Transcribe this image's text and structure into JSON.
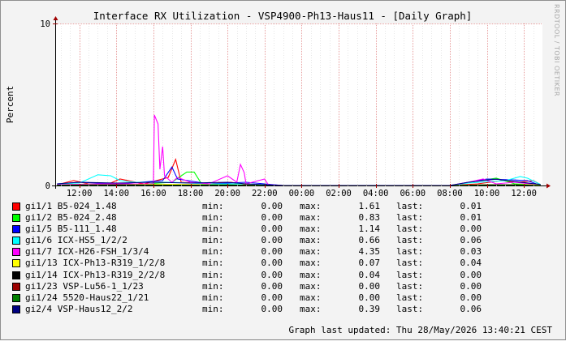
{
  "chart_data": {
    "type": "line",
    "title": "Interface RX Utilization - VSP4900-Ph13-Haus11 - [Daily Graph]",
    "ylabel": "Percent",
    "ylim": [
      0,
      10
    ],
    "yticks": [
      "0",
      "10"
    ],
    "xticks": [
      "12:00",
      "14:00",
      "16:00",
      "18:00",
      "20:00",
      "22:00",
      "00:00",
      "02:00",
      "04:00",
      "06:00",
      "08:00",
      "10:00",
      "12:00"
    ],
    "grid": true,
    "legend_position": "bottom",
    "series": [
      {
        "name": "gi1/1 B5-024_1.48",
        "color": "#ff0000",
        "min": "0.00",
        "max": "1.61",
        "last": "0.01",
        "points": [
          [
            10.8,
            0.05
          ],
          [
            11.7,
            0.3
          ],
          [
            12.5,
            0.1
          ],
          [
            13.5,
            0.05
          ],
          [
            14.2,
            0.4
          ],
          [
            15.5,
            0.1
          ],
          [
            16.8,
            0.5
          ],
          [
            17.2,
            1.61
          ],
          [
            17.5,
            0.2
          ],
          [
            19.0,
            0.1
          ],
          [
            20.2,
            0.2
          ],
          [
            21.0,
            0.05
          ],
          [
            23.0,
            0.0
          ],
          [
            32.0,
            0.0
          ],
          [
            33.5,
            0.1
          ],
          [
            34.8,
            0.3
          ],
          [
            35.7,
            0.2
          ],
          [
            36.5,
            0.3
          ],
          [
            36.9,
            0.05
          ]
        ]
      },
      {
        "name": "gi1/2 B5-024_2.48",
        "color": "#00ff00",
        "min": "0.00",
        "max": "0.83",
        "last": "0.01",
        "points": [
          [
            11.0,
            0.05
          ],
          [
            13.0,
            0.1
          ],
          [
            15.0,
            0.05
          ],
          [
            17.0,
            0.2
          ],
          [
            17.8,
            0.83
          ],
          [
            18.2,
            0.83
          ],
          [
            18.6,
            0.1
          ],
          [
            19.5,
            0.05
          ],
          [
            23.0,
            0.0
          ],
          [
            32.0,
            0.0
          ],
          [
            34.5,
            0.45
          ],
          [
            35.5,
            0.1
          ],
          [
            36.9,
            0.02
          ]
        ]
      },
      {
        "name": "gi1/5 B5-111_1.48",
        "color": "#0000ff",
        "min": "0.00",
        "max": "1.14",
        "last": "0.00",
        "points": [
          [
            10.8,
            0.1
          ],
          [
            12.0,
            0.2
          ],
          [
            14.0,
            0.1
          ],
          [
            16.5,
            0.3
          ],
          [
            17.0,
            1.14
          ],
          [
            17.3,
            0.4
          ],
          [
            19.0,
            0.1
          ],
          [
            21.0,
            0.2
          ],
          [
            23.0,
            0.0
          ],
          [
            32.0,
            0.0
          ],
          [
            33.0,
            0.2
          ],
          [
            34.0,
            0.4
          ],
          [
            35.3,
            0.35
          ],
          [
            36.2,
            0.3
          ],
          [
            36.9,
            0.0
          ]
        ]
      },
      {
        "name": "gi1/6 ICX-HS5_1/2/2",
        "color": "#00ffff",
        "min": "0.00",
        "max": "0.66",
        "last": "0.06",
        "points": [
          [
            10.8,
            0.1
          ],
          [
            12.0,
            0.15
          ],
          [
            13.0,
            0.66
          ],
          [
            13.7,
            0.6
          ],
          [
            14.2,
            0.3
          ],
          [
            15.0,
            0.2
          ],
          [
            17.0,
            0.2
          ],
          [
            19.0,
            0.1
          ],
          [
            21.0,
            0.1
          ],
          [
            23.0,
            0.0
          ],
          [
            32.0,
            0.0
          ],
          [
            33.0,
            0.15
          ],
          [
            35.0,
            0.3
          ],
          [
            35.8,
            0.55
          ],
          [
            36.2,
            0.45
          ],
          [
            36.9,
            0.06
          ]
        ]
      },
      {
        "name": "gi1/7 ICX-H26-FSH_1/3/4",
        "color": "#ff00ff",
        "min": "0.00",
        "max": "4.35",
        "last": "0.03",
        "points": [
          [
            10.8,
            0.05
          ],
          [
            13.0,
            0.1
          ],
          [
            15.0,
            0.1
          ],
          [
            16.0,
            0.1
          ],
          [
            16.05,
            4.35
          ],
          [
            16.25,
            3.8
          ],
          [
            16.35,
            1.0
          ],
          [
            16.5,
            2.4
          ],
          [
            16.6,
            0.6
          ],
          [
            17.0,
            0.2
          ],
          [
            17.3,
            0.5
          ],
          [
            18.0,
            0.2
          ],
          [
            19.0,
            0.1
          ],
          [
            20.0,
            0.6
          ],
          [
            20.5,
            0.2
          ],
          [
            20.7,
            1.3
          ],
          [
            20.9,
            0.8
          ],
          [
            21.0,
            0.1
          ],
          [
            22.0,
            0.4
          ],
          [
            22.2,
            0.05
          ],
          [
            23.0,
            0.0
          ],
          [
            32.0,
            0.0
          ],
          [
            33.0,
            0.2
          ],
          [
            33.8,
            0.4
          ],
          [
            34.5,
            0.1
          ],
          [
            35.5,
            0.2
          ],
          [
            36.9,
            0.03
          ]
        ]
      },
      {
        "name": "gi1/13 ICX-Ph13-R319_1/2/8",
        "color": "#ffff00",
        "min": "0.00",
        "max": "0.07",
        "last": "0.04",
        "points": [
          [
            10.8,
            0.02
          ],
          [
            14.0,
            0.05
          ],
          [
            17.0,
            0.07
          ],
          [
            20.0,
            0.03
          ],
          [
            23.0,
            0.0
          ],
          [
            32.0,
            0.0
          ],
          [
            34.0,
            0.05
          ],
          [
            36.9,
            0.04
          ]
        ]
      },
      {
        "name": "gi1/14 ICX-Ph13-R319_2/2/8",
        "color": "#000000",
        "min": "0.00",
        "max": "0.04",
        "last": "0.00",
        "points": [
          [
            10.8,
            0.02
          ],
          [
            14.0,
            0.04
          ],
          [
            17.0,
            0.02
          ],
          [
            20.0,
            0.03
          ],
          [
            23.0,
            0.0
          ],
          [
            32.0,
            0.0
          ],
          [
            34.0,
            0.04
          ],
          [
            35.6,
            0.04
          ],
          [
            36.9,
            0.0
          ]
        ]
      },
      {
        "name": "gi1/23 VSP-Lu56-1_1/23",
        "color": "#9b0000",
        "min": "0.00",
        "max": "0.00",
        "last": "0.00",
        "points": [
          [
            10.8,
            0.0
          ],
          [
            36.9,
            0.0
          ]
        ]
      },
      {
        "name": "gi1/24 5520-Haus22_1/21",
        "color": "#007f00",
        "min": "0.00",
        "max": "0.00",
        "last": "0.00",
        "points": [
          [
            10.8,
            0.0
          ],
          [
            36.9,
            0.0
          ]
        ]
      },
      {
        "name": "gi2/4 VSP-Haus12_2/2",
        "color": "#000080",
        "min": "0.00",
        "max": "0.39",
        "last": "0.06",
        "points": [
          [
            10.8,
            0.1
          ],
          [
            12.0,
            0.2
          ],
          [
            14.0,
            0.15
          ],
          [
            16.0,
            0.2
          ],
          [
            18.0,
            0.15
          ],
          [
            20.0,
            0.2
          ],
          [
            21.0,
            0.1
          ],
          [
            23.0,
            0.0
          ],
          [
            32.0,
            0.0
          ],
          [
            33.0,
            0.2
          ],
          [
            34.5,
            0.39
          ],
          [
            35.5,
            0.25
          ],
          [
            36.9,
            0.06
          ]
        ]
      }
    ]
  },
  "legend_labels": {
    "min": "min:",
    "max": "max:",
    "last": "last:"
  },
  "footer": {
    "updated": "Graph last updated: Thu 28/May/2026 13:40:21 CEST"
  },
  "watermark": "RRDTOOL / TOBI OETIKER"
}
